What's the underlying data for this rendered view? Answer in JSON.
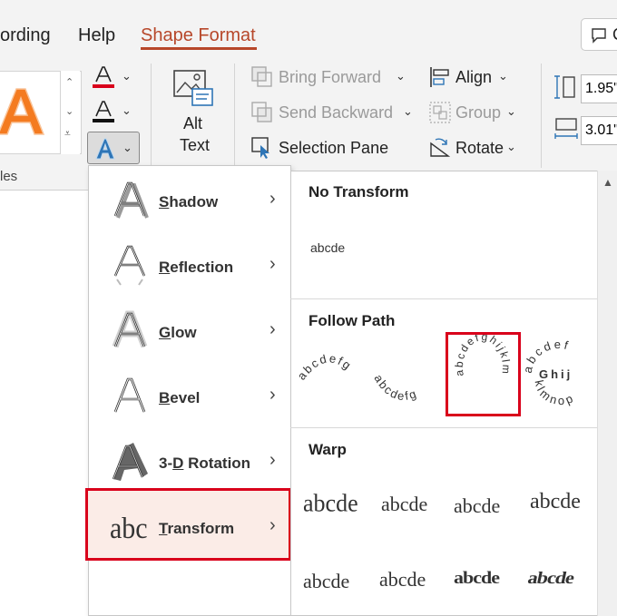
{
  "tabs": {
    "recording": "ording",
    "help": "Help",
    "shape_format": "Shape Format"
  },
  "ribbon": {
    "styles_group_label": "les",
    "alt_text_line1": "Alt",
    "alt_text_line2": "Text",
    "bring_forward": "Bring Forward",
    "send_backward": "Send Backward",
    "selection_pane": "Selection Pane",
    "align": "Align",
    "group": "Group",
    "rotate": "Rotate",
    "height_value": "1.95\"",
    "width_value": "3.01\"",
    "comments_glyph": "C"
  },
  "colors": {
    "accent": "#b7472a",
    "highlight_border": "#d9001b",
    "wordart_orange": "#f47b20",
    "text_fill_underline": "#d9001b",
    "text_effects_blue": "#2e75b6"
  },
  "menu": {
    "items": [
      {
        "key": "S",
        "rest": "hadow",
        "icon": "shadow-a-icon"
      },
      {
        "key": "R",
        "rest": "eflection",
        "icon": "reflection-a-icon"
      },
      {
        "key": "G",
        "rest": "low",
        "icon": "glow-a-icon"
      },
      {
        "key": "B",
        "rest": "evel",
        "icon": "bevel-a-icon"
      },
      {
        "pre": "3-",
        "key": "D",
        "rest": " Rotation",
        "icon": "3d-rotation-a-icon"
      },
      {
        "key": "T",
        "rest": "ransform",
        "icon": "transform-abc-icon"
      }
    ],
    "selected_index": 5
  },
  "gallery": {
    "no_transform_heading": "No Transform",
    "no_transform_sample": "abcde",
    "follow_path_heading": "Follow Path",
    "arch_sample": "abcdefg",
    "wave_sample": "abcdefg",
    "circle_sample": "abcdefghijklm",
    "button_outer": "abcdef",
    "button_middle": "Ghij",
    "button_inner": "klmnop",
    "warp_heading": "Warp",
    "warp_sample": "abcde"
  }
}
